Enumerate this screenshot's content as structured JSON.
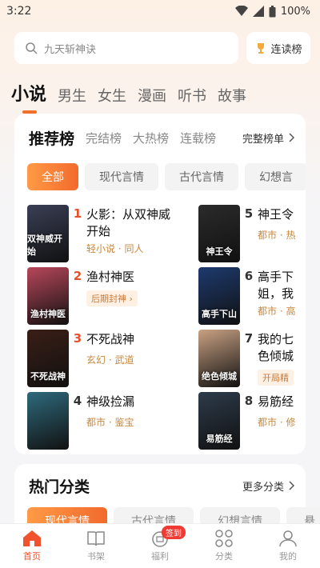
{
  "status": {
    "time": "3:22",
    "battery": "100%"
  },
  "search": {
    "placeholder": "九天斩神诀",
    "continue_label": "连读榜"
  },
  "category_tabs": [
    "小说",
    "男生",
    "女生",
    "漫画",
    "听书",
    "故事"
  ],
  "ranking": {
    "title": "推荐榜",
    "subtabs": [
      "完结榜",
      "大热榜",
      "连载榜"
    ],
    "full_list": "完整榜单",
    "chips": [
      "全部",
      "现代言情",
      "古代言情",
      "幻想言"
    ],
    "books": [
      {
        "rank": "1",
        "title_line1": "火影：从双神威",
        "title_line2": "开始",
        "tag": "轻小说 · 同人",
        "cover_text": "双神威开始",
        "cover_color": "#3a3f55"
      },
      {
        "rank": "2",
        "title_line1": "渔村神医",
        "title_line2": "",
        "badge": "后期封神 ›",
        "cover_text": "渔村神医",
        "cover_color": "#b8475a"
      },
      {
        "rank": "3",
        "title_line1": "不死战神",
        "title_line2": "",
        "tag": "玄幻 · 武道",
        "cover_text": "不死战神",
        "cover_color": "#3a1e16"
      },
      {
        "rank": "4",
        "title_line1": "神级捡漏",
        "title_line2": "",
        "tag": "都市 · 鉴宝",
        "cover_text": "",
        "cover_color": "#2e6a7c"
      },
      {
        "rank": "5",
        "title_line1": "神王令",
        "title_line2": "",
        "tag": "都市 · 热",
        "cover_text": "神王令",
        "cover_color": "#2b2b2b"
      },
      {
        "rank": "6",
        "title_line1": "高手下",
        "title_line2": "姐，我",
        "tag": "都市 · 高",
        "cover_text": "高手下山",
        "cover_color": "#1d3a6e"
      },
      {
        "rank": "7",
        "title_line1": "我的七",
        "title_line2": "色倾城",
        "badge": "开局精",
        "cover_text": "绝色倾城",
        "cover_color": "#c9a183"
      },
      {
        "rank": "8",
        "title_line1": "易筋经",
        "title_line2": "",
        "tag": "都市 · 修",
        "cover_text": "易筋经",
        "cover_color": "#2d3b4a"
      }
    ]
  },
  "hot": {
    "title": "热门分类",
    "more": "更多分类",
    "chips": [
      "现代言情",
      "古代言情",
      "幻想言情",
      "悬"
    ]
  },
  "nav": [
    {
      "label": "首页",
      "icon": "home-icon"
    },
    {
      "label": "书架",
      "icon": "bookshelf-icon"
    },
    {
      "label": "福利",
      "icon": "gift-icon",
      "badge": "签到"
    },
    {
      "label": "分类",
      "icon": "category-icon"
    },
    {
      "label": "我的",
      "icon": "user-icon"
    }
  ],
  "colors": {
    "accent": "#f0702a",
    "rank_top": "#e8502c"
  }
}
